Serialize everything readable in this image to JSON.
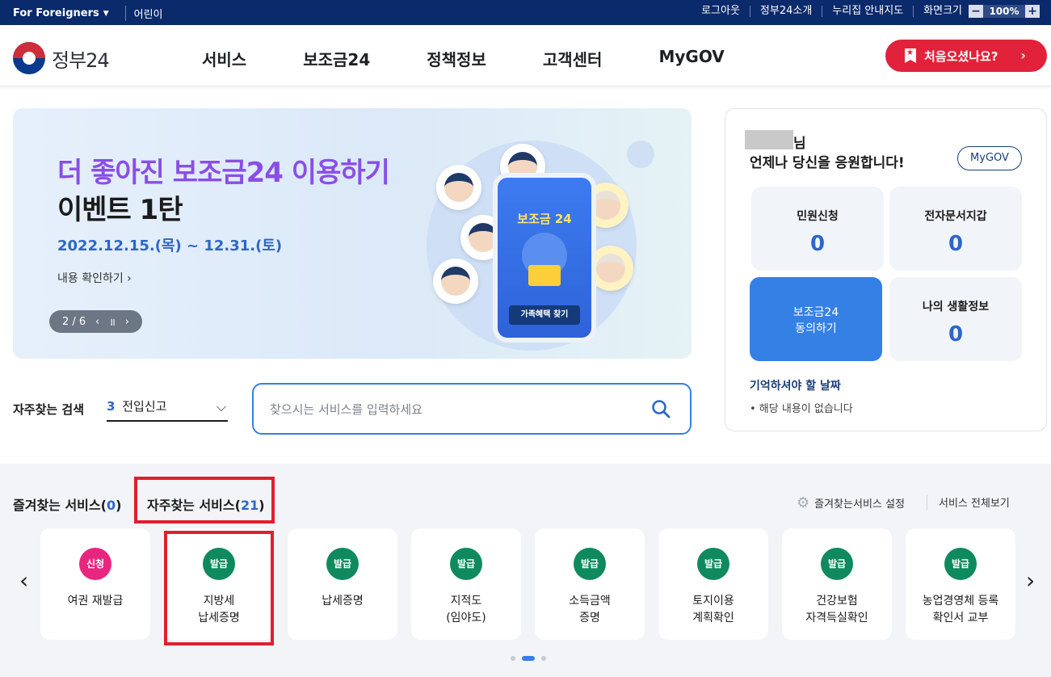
{
  "topbar": {
    "foreigners": "For Foreigners",
    "kids": "어린이",
    "links": [
      "로그아웃",
      "정부24소개",
      "누리집 안내지도",
      "화면크기"
    ],
    "zoom_minus": "−",
    "zoom_value": "100%",
    "zoom_plus": "+"
  },
  "header": {
    "logo_text": "정부24",
    "nav": [
      "서비스",
      "보조금24",
      "정책정보",
      "고객센터",
      "MyGOV"
    ],
    "first_visit_button": "처음오셨나요?"
  },
  "banner": {
    "headline": "더 좋아진 보조금24 이용하기",
    "subheadline": "이벤트 1탄",
    "date": "2022.12.15.(목) ~ 12.31.(토)",
    "more": "내용 확인하기 ›",
    "pager": "2 / 6",
    "phone_title": "보조금 24",
    "phone_button": "가족혜택 찾기"
  },
  "user_panel": {
    "suffix": "님",
    "greeting": "언제나 당신을 응원합니다!",
    "mygov_button": "MyGOV",
    "tiles": [
      {
        "label": "민원신청",
        "value": "0"
      },
      {
        "label": "전자문서지갑",
        "value": "0"
      },
      {
        "label": "보조금24\n동의하기"
      },
      {
        "label": "나의 생활정보",
        "value": "0"
      }
    ],
    "remember_title": "기억하셔야 할 날짜",
    "remember_empty": "• 해당 내용이 없습니다"
  },
  "search": {
    "label": "자주찾는 검색",
    "selected_num": "3",
    "selected_text": "전입신고",
    "placeholder": "찾으시는 서비스를 입력하세요"
  },
  "services": {
    "favorites_label": "즐겨찾는 서비스",
    "favorites_count": "0",
    "frequent_label": "자주찾는 서비스",
    "frequent_count": "21",
    "settings": "즐겨찾는서비스 설정",
    "view_all": "서비스 전체보기",
    "cards": [
      {
        "badge": "신청",
        "label": "여권 재발급",
        "color": "#e9267f"
      },
      {
        "badge": "발급",
        "label": "지방세\n납세증명",
        "color": "#0f8a5f"
      },
      {
        "badge": "발급",
        "label": "납세증명",
        "color": "#0f8a5f"
      },
      {
        "badge": "발급",
        "label": "지적도\n(임야도)",
        "color": "#0f8a5f"
      },
      {
        "badge": "발급",
        "label": "소득금액\n증명",
        "color": "#0f8a5f"
      },
      {
        "badge": "발급",
        "label": "토지이용\n계획확인",
        "color": "#0f8a5f"
      },
      {
        "badge": "발급",
        "label": "건강보험\n자격득실확인",
        "color": "#0f8a5f"
      },
      {
        "badge": "발급",
        "label": "농업경영체 등록\n확인서 교부",
        "color": "#0f8a5f"
      }
    ]
  }
}
